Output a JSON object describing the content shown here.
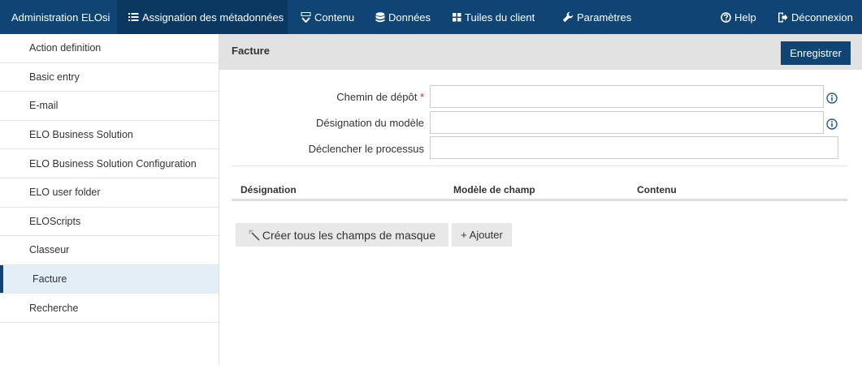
{
  "topnav": {
    "brand": "Administration ELOsi",
    "items": [
      {
        "label": "Assignation des métadonnées",
        "icon": "list-icon"
      },
      {
        "label": "Contenu",
        "icon": "content-icon"
      },
      {
        "label": "Données",
        "icon": "database-icon"
      },
      {
        "label": "Tuiles du client",
        "icon": "tiles-icon"
      },
      {
        "label": "Paramètres",
        "icon": "wrench-icon"
      }
    ],
    "help": "Help",
    "logout": "Déconnexion"
  },
  "sidebar": {
    "items": [
      {
        "label": "Action definition"
      },
      {
        "label": "Basic entry"
      },
      {
        "label": "E-mail"
      },
      {
        "label": "ELO Business Solution"
      },
      {
        "label": "ELO Business Solution Configuration"
      },
      {
        "label": "ELO user folder"
      },
      {
        "label": "ELOScripts"
      },
      {
        "label": "Classeur"
      },
      {
        "label": "Facture"
      },
      {
        "label": "Recherche"
      }
    ],
    "active_label": "Facture"
  },
  "panel": {
    "title": "Facture",
    "save_label": "Enregistrer"
  },
  "form": {
    "fields": [
      {
        "label": "Chemin de dépôt",
        "required_mark": "*",
        "value": ""
      },
      {
        "label": "Désignation du modèle",
        "value": ""
      },
      {
        "label": "Déclencher le processus",
        "value": ""
      }
    ]
  },
  "table": {
    "headers": [
      "Désignation",
      "Modèle de champ",
      "Contenu"
    ]
  },
  "actions": {
    "create_all": "Créer tous les champs de masque",
    "add": "+ Ajouter"
  },
  "colors": {
    "topbar": "#0f4475",
    "primary_button": "#0f4475",
    "required": "#c0392b"
  }
}
